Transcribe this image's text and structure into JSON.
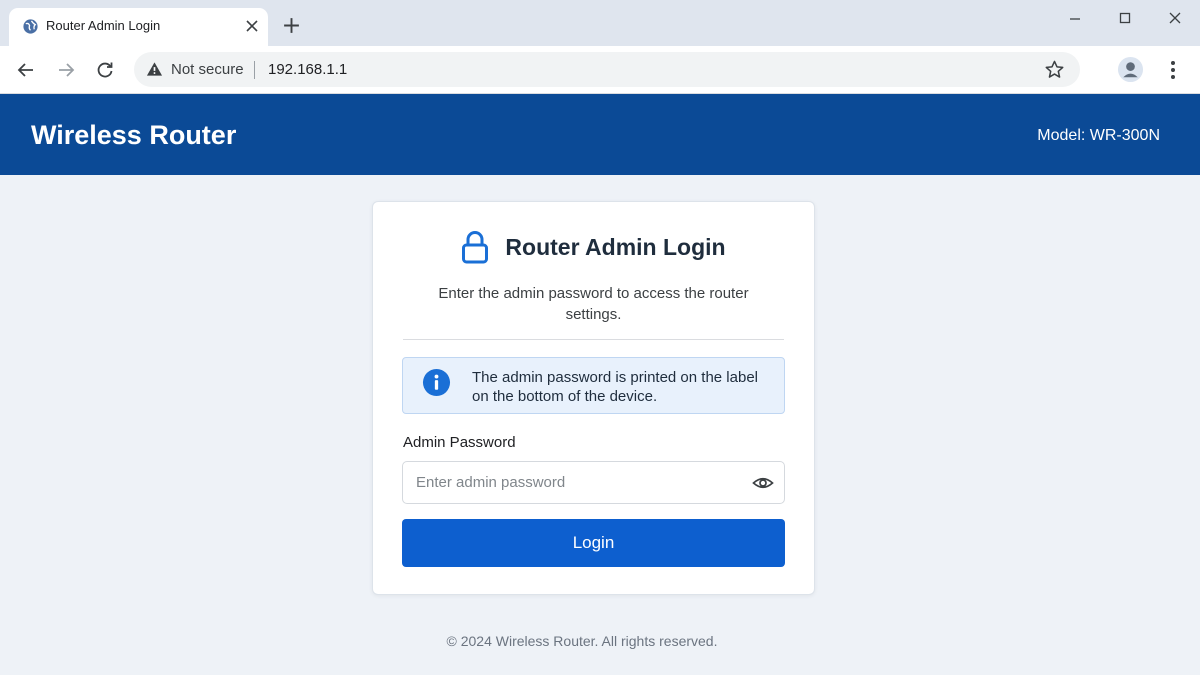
{
  "browser": {
    "tab_title": "Router Admin Login",
    "security_label": "Not secure",
    "url": "192.168.1.1"
  },
  "header": {
    "brand": "Wireless Router",
    "model": "Model: WR-300N"
  },
  "login": {
    "title": "Router Admin Login",
    "subtitle": "Enter the admin password to access the router settings.",
    "info": "The admin password is printed on the label on the bottom of the device.",
    "password_label": "Admin Password",
    "password_placeholder": "Enter admin password",
    "password_value": "",
    "button_label": "Login"
  },
  "footer": {
    "text": "© 2024 Wireless Router. All rights reserved."
  },
  "icons": {
    "favicon": "globe-icon",
    "tab_close": "close-icon",
    "new_tab": "plus-icon",
    "minimize": "minimize-icon",
    "maximize": "maximize-icon",
    "close_window": "close-icon",
    "back": "arrow-left-icon",
    "forward": "arrow-right-icon",
    "reload": "reload-icon",
    "security": "warning-triangle-icon",
    "bookmark": "star-icon",
    "profile": "profile-icon",
    "menu": "kebab-menu-icon",
    "lock": "lock-icon",
    "info": "info-icon",
    "show_password": "eye-icon"
  },
  "colors": {
    "header_bg": "#0b4a96",
    "button_bg": "#0d5fcf",
    "info_bg": "#e8f1fc",
    "info_icon": "#1a6fd6",
    "page_bg": "#eef2f7"
  }
}
